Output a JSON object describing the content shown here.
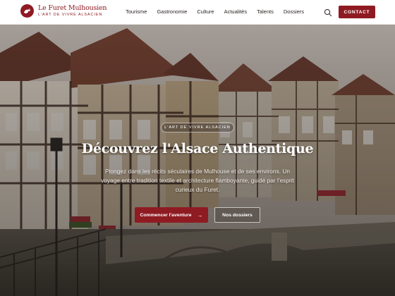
{
  "brand": {
    "name": "Le Furet Mulhousien",
    "tagline": "L'ART DE VIVRE ALSACIEN",
    "logo_icon": "ferret-logo-icon",
    "accent_color": "#8f1b22"
  },
  "nav": {
    "items": [
      {
        "label": "Tourisme"
      },
      {
        "label": "Gastronomie"
      },
      {
        "label": "Culture"
      },
      {
        "label": "Actualités"
      },
      {
        "label": "Talents"
      },
      {
        "label": "Dossiers"
      }
    ],
    "search_icon": "search-icon",
    "contact_label": "CONTACT"
  },
  "hero": {
    "badge": "L'ART DE VIVRE ALSACIEN",
    "title": "Découvrez l'Alsace Authentique",
    "text": "Plongez dans les récits séculaires de Mulhouse et de ses environs. Un voyage entre tradition textile et architecture flamboyante, guidé par l'esprit curieux du Furet.",
    "primary_button": "Commencer l'aventure",
    "primary_icon": "arrow-right-icon",
    "secondary_button": "Nos dossiers",
    "background_image": "half-timbered-houses-canal-photo"
  }
}
